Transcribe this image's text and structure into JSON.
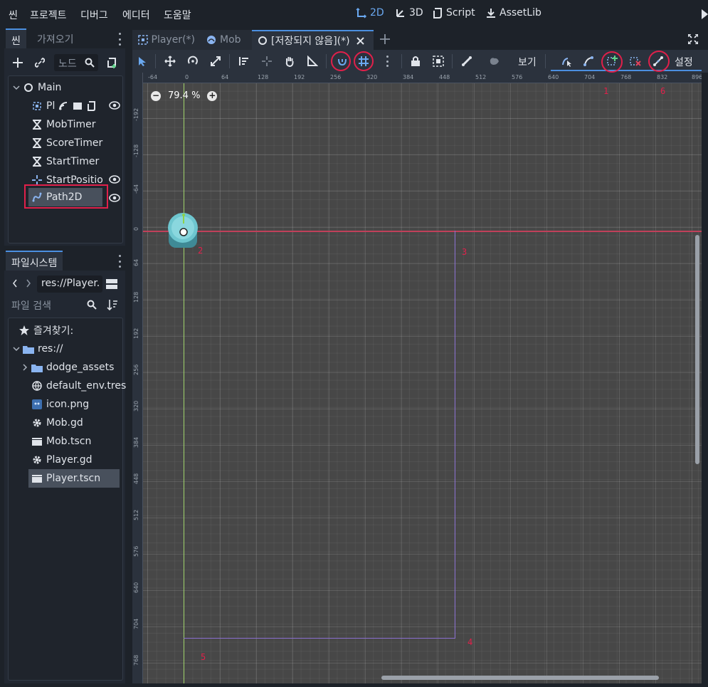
{
  "menu": {
    "items": [
      "씬",
      "프로젝트",
      "디버그",
      "에디터",
      "도움말"
    ]
  },
  "modes": {
    "btn_2d": "2D",
    "btn_3d": "3D",
    "btn_script": "Script",
    "btn_assetlib": "AssetLib"
  },
  "scene_dock": {
    "tab_scene": "씬",
    "tab_import": "가져오기",
    "filter_placeholder": "노드",
    "tree": [
      {
        "label": "Main"
      },
      {
        "label": "Pl"
      },
      {
        "label": "MobTimer"
      },
      {
        "label": "ScoreTimer"
      },
      {
        "label": "StartTimer"
      },
      {
        "label": "StartPositio"
      },
      {
        "label": "Path2D"
      }
    ]
  },
  "fs_dock": {
    "tab_title": "파일시스템",
    "path": "res://Player.",
    "search_placeholder": "파일 검색",
    "favorites": "즐겨찾기:",
    "root": "res://",
    "items": [
      "dodge_assets",
      "default_env.tres",
      "icon.png",
      "Mob.gd",
      "Mob.tscn",
      "Player.gd",
      "Player.tscn"
    ]
  },
  "editor_tabs": [
    {
      "label": "Player(*)"
    },
    {
      "label": "Mob"
    },
    {
      "label": "[저장되지 않음](*)"
    }
  ],
  "toolbar": {
    "view_label": "보기",
    "settings_label": "설정"
  },
  "viewport": {
    "zoom_label": "79.4 %",
    "ruler_h": [
      "-64",
      "0",
      "64",
      "128",
      "192",
      "256",
      "320",
      "384",
      "448",
      "512",
      "576",
      "640",
      "704",
      "768",
      "832",
      "896"
    ],
    "ruler_v": [
      "-192",
      "-128",
      "-64",
      "0",
      "64",
      "128",
      "192",
      "256",
      "320",
      "384",
      "448",
      "512",
      "576",
      "640",
      "704",
      "768"
    ],
    "annotations": [
      "1",
      "6",
      "2",
      "3",
      "4",
      "5"
    ]
  },
  "colors": {
    "accent": "#4b8fe0",
    "highlight_red": "#e0204a",
    "grid_bg": "#474747"
  }
}
